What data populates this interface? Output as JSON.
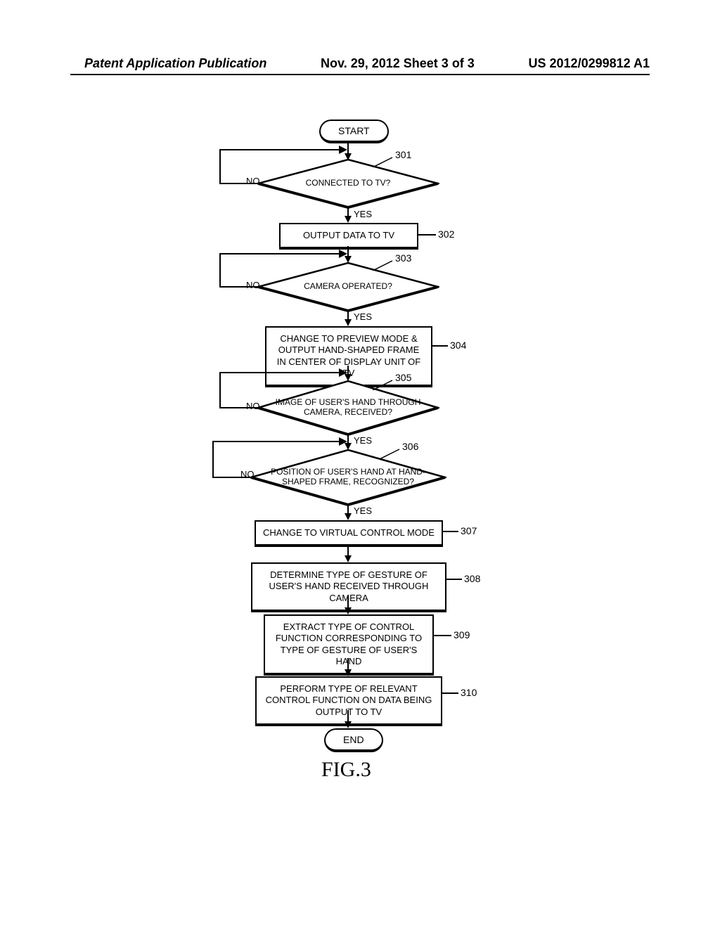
{
  "header": {
    "left": "Patent Application Publication",
    "center": "Nov. 29, 2012  Sheet 3 of 3",
    "right": "US 2012/0299812 A1"
  },
  "chart_data": {
    "type": "flowchart",
    "nodes": {
      "start": {
        "kind": "terminal",
        "text": "START"
      },
      "d301": {
        "kind": "decision",
        "text": "CONNECTED TO TV?",
        "ref": "301"
      },
      "p302": {
        "kind": "process",
        "text": "OUTPUT DATA TO TV",
        "ref": "302"
      },
      "d303": {
        "kind": "decision",
        "text": "CAMERA OPERATED?",
        "ref": "303"
      },
      "p304": {
        "kind": "process",
        "text": "CHANGE TO PREVIEW MODE & OUTPUT HAND-SHAPED FRAME IN CENTER OF DISPLAY UNIT OF TV",
        "ref": "304"
      },
      "d305": {
        "kind": "decision",
        "text": "IMAGE OF USER'S HAND THROUGH CAMERA, RECEIVED?",
        "ref": "305"
      },
      "d306": {
        "kind": "decision",
        "text": "POSITION OF USER'S HAND AT HAND-SHAPED FRAME, RECOGNIZED?",
        "ref": "306"
      },
      "p307": {
        "kind": "process",
        "text": "CHANGE TO VIRTUAL CONTROL MODE",
        "ref": "307"
      },
      "p308": {
        "kind": "process",
        "text": "DETERMINE TYPE OF GESTURE OF USER'S HAND RECEIVED THROUGH CAMERA",
        "ref": "308"
      },
      "p309": {
        "kind": "process",
        "text": "EXTRACT TYPE OF CONTROL FUNCTION CORRESPONDING TO TYPE OF GESTURE OF USER'S HAND",
        "ref": "309"
      },
      "p310": {
        "kind": "process",
        "text": "PERFORM TYPE OF RELEVANT CONTROL FUNCTION ON DATA BEING OUTPUT TO TV",
        "ref": "310"
      },
      "end": {
        "kind": "terminal",
        "text": "END"
      }
    },
    "edges": [
      {
        "from": "start",
        "to": "d301"
      },
      {
        "from": "d301",
        "to": "p302",
        "label": "YES"
      },
      {
        "from": "d301",
        "to": "d301",
        "label": "NO",
        "loop": true
      },
      {
        "from": "p302",
        "to": "d303"
      },
      {
        "from": "d303",
        "to": "p304",
        "label": "YES"
      },
      {
        "from": "d303",
        "to": "d303",
        "label": "NO",
        "loop": true
      },
      {
        "from": "p304",
        "to": "d305"
      },
      {
        "from": "d305",
        "to": "d306",
        "label": "YES"
      },
      {
        "from": "d305",
        "to": "d305",
        "label": "NO",
        "loop": true
      },
      {
        "from": "d306",
        "to": "p307",
        "label": "YES"
      },
      {
        "from": "d306",
        "to": "d305",
        "label": "NO",
        "loop": true
      },
      {
        "from": "p307",
        "to": "p308"
      },
      {
        "from": "p308",
        "to": "p309"
      },
      {
        "from": "p309",
        "to": "p310"
      },
      {
        "from": "p310",
        "to": "end"
      }
    ],
    "labels": {
      "yes": "YES",
      "no": "NO"
    },
    "figure_label": "FIG.3"
  }
}
